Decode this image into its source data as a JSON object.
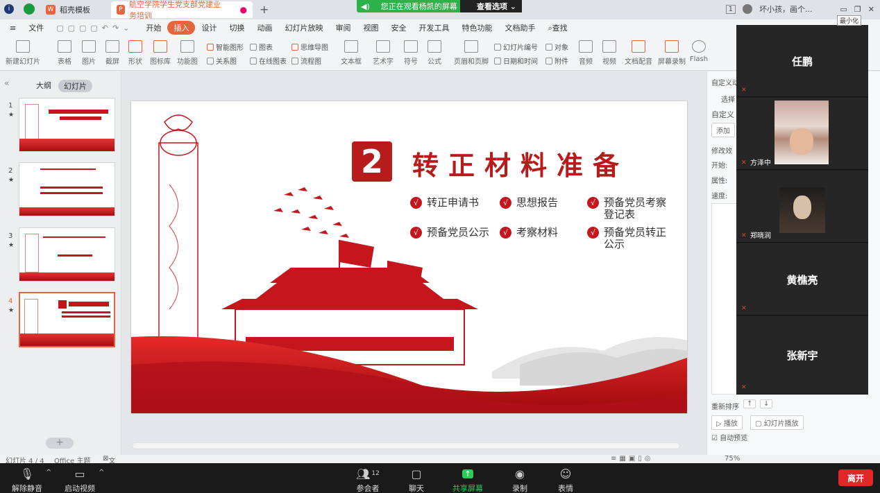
{
  "tabs": [
    {
      "label": "稻壳模板"
    },
    {
      "label": "航空学院学生党支部党建业务培训"
    }
  ],
  "share_banner": {
    "text": "您正在观看杨凯的屏幕",
    "view_option": "查看选项"
  },
  "window_right": {
    "badge": "1",
    "user": "坏小孩，画个...",
    "minimize_tip": "最小化"
  },
  "menu": {
    "file": "文件",
    "items": [
      "开始",
      "插入",
      "设计",
      "切换",
      "动画",
      "幻灯片放映",
      "审阅",
      "视图",
      "安全",
      "开发工具",
      "特色功能",
      "文档助手",
      "查找"
    ],
    "active": "插入"
  },
  "ribbon": {
    "big": [
      "新建幻灯片",
      "表格",
      "图片",
      "截屏",
      "形状",
      "图标库",
      "功能图",
      "文本框",
      "艺术字",
      "符号",
      "公式",
      "页眉和页脚",
      "文档配音",
      "屏幕录制",
      "Flash",
      "音频",
      "视频"
    ],
    "small": [
      "智能图形",
      "图表",
      "关系图",
      "在线图表",
      "思维导图",
      "流程图",
      "幻灯片编号",
      "对象",
      "日期和时间",
      "附件"
    ]
  },
  "left_panel": {
    "tab_outline": "大纲",
    "tab_slides": "幻灯片",
    "slide_numbers": [
      "1",
      "2",
      "3",
      "4"
    ],
    "selected": 4,
    "add": "+"
  },
  "slide": {
    "number": "2",
    "title": "转正材料准备",
    "items": [
      "转正申请书",
      "思想报告",
      "预备党员考察登记表",
      "预备党员公示",
      "考察材料",
      "预备党员转正公示"
    ],
    "check": "√"
  },
  "right_panel": {
    "title": "自定义动",
    "select": "选择",
    "custom": "自定义",
    "add": "添加",
    "modify": "修改效",
    "start": "开始:",
    "property": "属性:",
    "speed": "速度:",
    "reorder": "重新排序",
    "play": "播放",
    "slideshow": "幻灯片播放",
    "autopreview": "自动预览"
  },
  "participants": [
    {
      "name": "任鹏",
      "video": false
    },
    {
      "name": "方泽中",
      "video": true
    },
    {
      "name": "郑晓润",
      "video": true
    },
    {
      "name": "黄樵亮",
      "video": false
    },
    {
      "name": "张新宇",
      "video": false
    }
  ],
  "status": {
    "slide_pos": "幻灯片 4 / 4",
    "theme": "Office 主题",
    "protected": "文档未保护",
    "zoom": "75%"
  },
  "zoom_bar": {
    "mute": "解除静音",
    "video": "启动视频",
    "participants": "参会者",
    "participant_count": "12",
    "chat": "聊天",
    "share": "共享屏幕",
    "record": "录制",
    "reactions": "表情",
    "leave": "离开"
  }
}
